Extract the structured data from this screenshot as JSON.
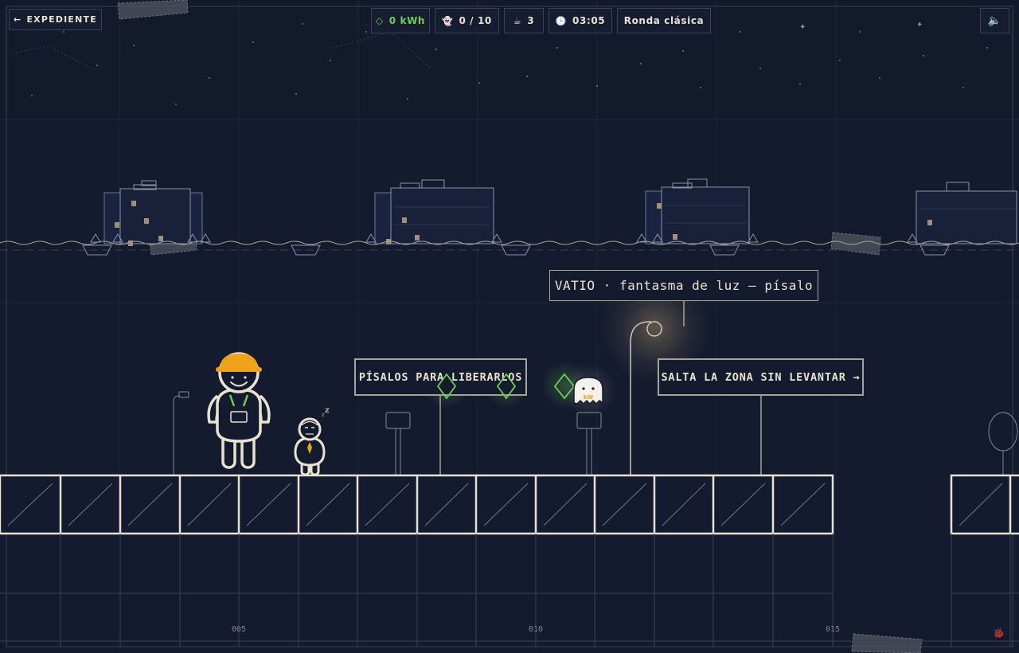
{
  "hud": {
    "back_label": "EXPEDIENTE",
    "back_arrow": "←",
    "energy_icon": "◇",
    "energy_value": "0 kWh",
    "ghosts_icon": "👻",
    "ghosts_value": "0 / 10",
    "coffee_icon": "☕",
    "coffee_value": "3",
    "clock_icon": "🕒",
    "time_value": "03:05",
    "mode_label": "Ronda clásica",
    "sound_icon": "🔈"
  },
  "signs": {
    "tutorial_step": "PÍSALOS PARA LIBERARLOS",
    "jump_hint": "SALTA LA ZONA SIN LEVANTAR →",
    "vatio_label": "VATIO · fantasma de luz — písalo"
  },
  "ghost": {
    "badge": "kW"
  },
  "sleep_mark": "z",
  "floor_ticks": [
    "005",
    "010",
    "015"
  ],
  "debug_icon": "🐞",
  "colors": {
    "background": "#141b2e",
    "line": "#e8e2d0",
    "accent_green": "#6fce55",
    "helmet": "#f0a21a",
    "lamp_glow": "#f3c98a"
  }
}
